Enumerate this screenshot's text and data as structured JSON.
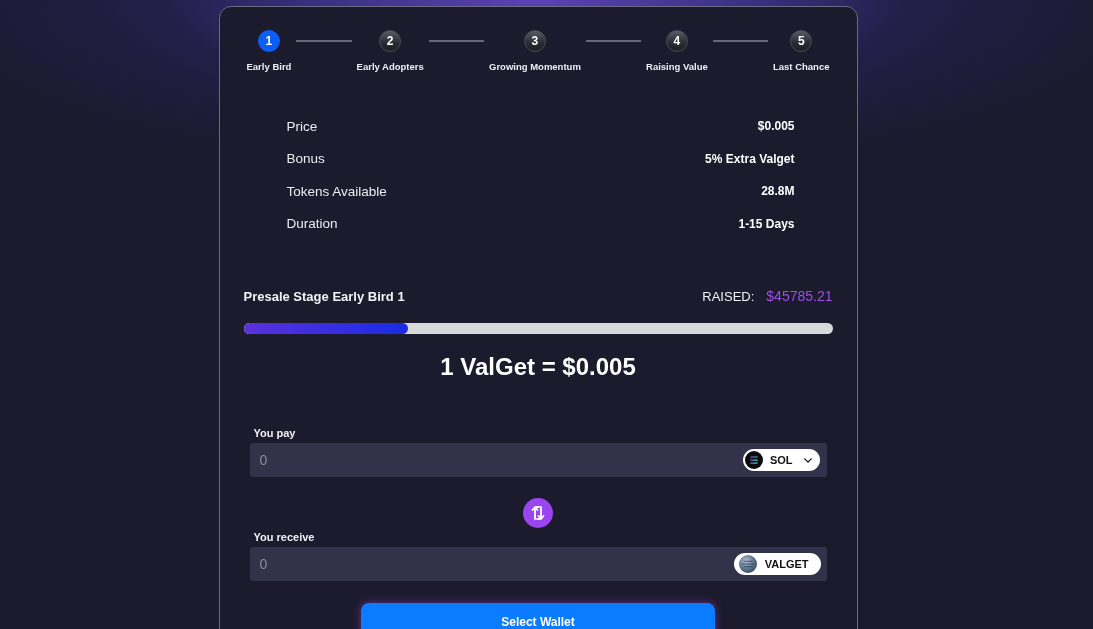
{
  "stepper": {
    "steps": [
      {
        "number": "1",
        "label": "Early Bird",
        "selected": true
      },
      {
        "number": "2",
        "label": "Early Adopters",
        "selected": false
      },
      {
        "number": "3",
        "label": "Growing Momentum",
        "selected": false
      },
      {
        "number": "4",
        "label": "Raising Value",
        "selected": false
      },
      {
        "number": "5",
        "label": "Last Chance",
        "selected": false
      }
    ]
  },
  "stage_details": [
    {
      "label": "Price",
      "value": "$0.005"
    },
    {
      "label": "Bonus",
      "value": "5% Extra Valget"
    },
    {
      "label": "Tokens Available",
      "value": "28.8M"
    },
    {
      "label": "Duration",
      "value": "1-15 Days"
    }
  ],
  "presale": {
    "stage_title": "Presale Stage Early Bird 1",
    "raised_label": "RAISED:",
    "raised_value": "$45785.21",
    "progress": {
      "level": 0.28
    },
    "rate": "1 ValGet = $0.005"
  },
  "swap": {
    "fields": [
      {
        "label": "You pay",
        "placeholder": "0",
        "token": {
          "symbol": "SOL",
          "kind": "sol",
          "dropdown": true
        }
      },
      {
        "label": "You receive",
        "placeholder": "0",
        "token": {
          "symbol": "VALGET",
          "kind": "valget",
          "dropdown": false
        }
      }
    ]
  },
  "wallet_button": {
    "label": "Select Wallet"
  }
}
